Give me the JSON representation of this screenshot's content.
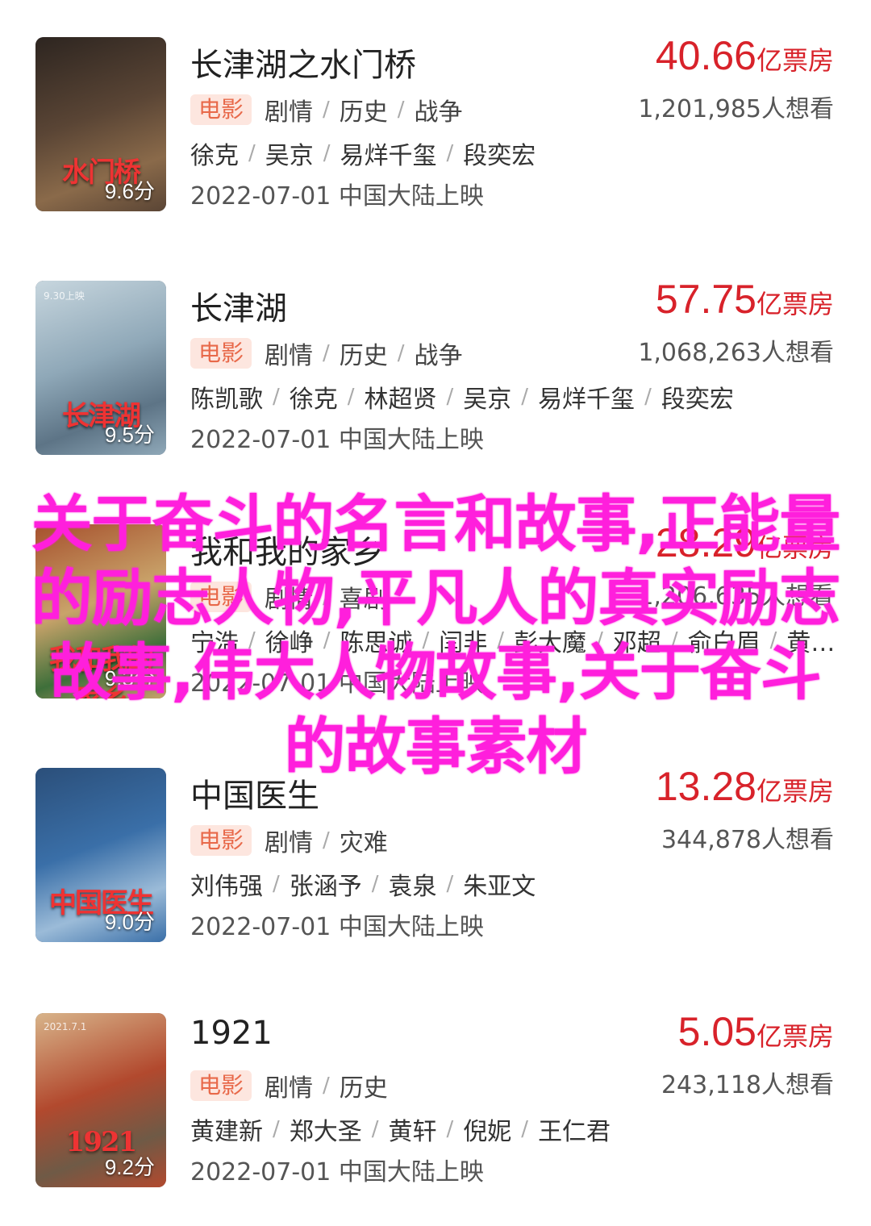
{
  "colors": {
    "accent_red": "#d8222a",
    "badge_bg": "#fde6df",
    "badge_text": "#e8694a",
    "overlay_magenta": "#ff1fdc"
  },
  "movies": [
    {
      "title": "长津湖之水门桥",
      "box_office_value": "40.66",
      "box_office_unit": "亿票房",
      "type": "电影",
      "genres": [
        "剧情",
        "历史",
        "战争"
      ],
      "want_count": "1,201,985人想看",
      "cast": [
        "徐克",
        "吴京",
        "易烊千玺",
        "段奕宏"
      ],
      "release": "2022-07-01 中国大陆上映",
      "rating": "9.6分",
      "poster_text": "水门桥",
      "poster_colors": [
        "#5a4535",
        "#8a6a4a",
        "#2d2520"
      ]
    },
    {
      "title": "长津湖",
      "box_office_value": "57.75",
      "box_office_unit": "亿票房",
      "type": "电影",
      "genres": [
        "剧情",
        "历史",
        "战争"
      ],
      "want_count": "1,068,263人想看",
      "cast": [
        "陈凯歌",
        "徐克",
        "林超贤",
        "吴京",
        "易烊千玺",
        "段奕宏"
      ],
      "release": "2022-07-01 中国大陆上映",
      "rating": "9.5分",
      "poster_header": "9.30上映",
      "poster_text": "长津湖",
      "poster_colors": [
        "#8fa8b8",
        "#5d7486",
        "#c7d6de"
      ]
    },
    {
      "title": "我和我的家乡",
      "box_office_value": "28.29",
      "box_office_unit": "亿票房",
      "type": "电影",
      "genres": [
        "剧情",
        "喜剧"
      ],
      "want_count": "1,206,635人想看",
      "cast": [
        "宁浩",
        "徐峥",
        "陈思诚",
        "闫非",
        "彭大魔",
        "邓超",
        "俞白眉",
        "黄…"
      ],
      "release": "2022-07-01 中国大陆上映",
      "rating": "9.3分",
      "poster_text": "我和我的家乡",
      "poster_colors": [
        "#c9a36a",
        "#3e6f3a",
        "#a6502d"
      ]
    },
    {
      "title": "中国医生",
      "box_office_value": "13.28",
      "box_office_unit": "亿票房",
      "type": "电影",
      "genres": [
        "剧情",
        "灾难"
      ],
      "want_count": "344,878人想看",
      "cast": [
        "刘伟强",
        "张涵予",
        "袁泉",
        "朱亚文"
      ],
      "release": "2022-07-01 中国大陆上映",
      "rating": "9.0分",
      "poster_text": "中国医生",
      "poster_colors": [
        "#3a6fa8",
        "#9bbbd8",
        "#2b4f7a"
      ]
    },
    {
      "title": "1921",
      "box_office_value": "5.05",
      "box_office_unit": "亿票房",
      "type": "电影",
      "genres": [
        "剧情",
        "历史"
      ],
      "want_count": "243,118人想看",
      "cast": [
        "黄建新",
        "郑大圣",
        "黄轩",
        "倪妮",
        "王仁君"
      ],
      "release": "2022-07-01 中国大陆上映",
      "rating": "9.2分",
      "poster_header": "2021.7.1",
      "poster_text": "1921",
      "poster_colors": [
        "#b2492e",
        "#6f5a46",
        "#d8b48a"
      ]
    }
  ],
  "overlay_headline": "关于奋斗的名言和故事,正能量的励志人物,平凡人的真实励志故事,伟大人物故事,关于奋斗的故事素材"
}
